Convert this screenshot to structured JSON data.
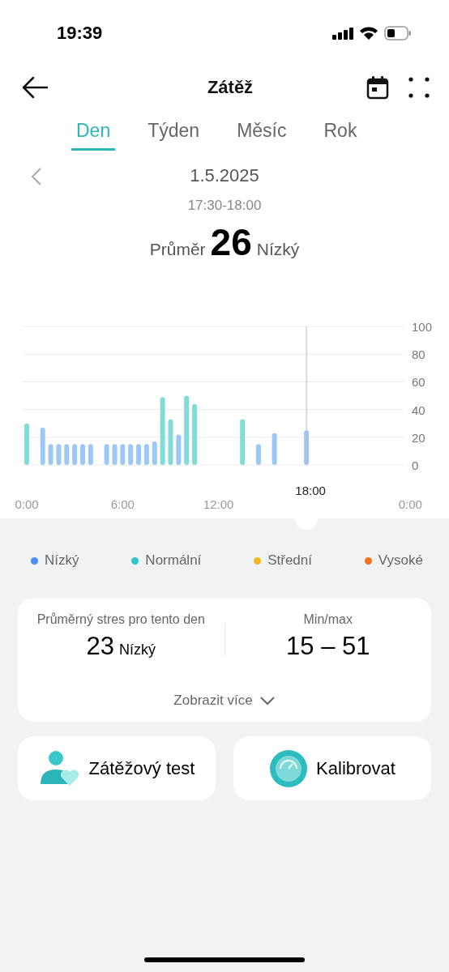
{
  "status_bar": {
    "time": "19:39"
  },
  "header": {
    "title": "Zátěž"
  },
  "tabs": [
    {
      "label": "Den",
      "selected": true
    },
    {
      "label": "Týden",
      "selected": false
    },
    {
      "label": "Měsíc",
      "selected": false
    },
    {
      "label": "Rok",
      "selected": false
    }
  ],
  "date_nav": {
    "date": "1.5.2025",
    "time_range": "17:30-18:00"
  },
  "summary": {
    "label": "Průměr",
    "value": "26",
    "level": "Nízký"
  },
  "chart": {
    "chart_data": {
      "type": "bar",
      "x": [
        0,
        1,
        1.5,
        2,
        2.5,
        3,
        3.5,
        4,
        5,
        5.5,
        6,
        6.5,
        7,
        7.5,
        8,
        8.5,
        9,
        9.5,
        10,
        10.5,
        13.5,
        14.5,
        15.5,
        17.5
      ],
      "series": [
        {
          "color": "#9cc8f8",
          "values": [
            null,
            27,
            15,
            15,
            15,
            15,
            15,
            15,
            15,
            15,
            15,
            15,
            15,
            15,
            17,
            null,
            null,
            22,
            null,
            null,
            null,
            15,
            23,
            25
          ]
        },
        {
          "color": "#7fdcd8",
          "values": [
            30,
            null,
            null,
            null,
            null,
            null,
            null,
            null,
            null,
            null,
            null,
            null,
            null,
            null,
            null,
            49,
            33,
            null,
            50,
            44,
            33,
            null,
            null,
            null
          ]
        }
      ],
      "xlim": [
        0,
        24
      ],
      "ylim": [
        0,
        100
      ],
      "yticks": [
        0,
        20,
        40,
        60,
        80,
        100
      ],
      "xticks": [
        {
          "value": 0,
          "label": "0:00"
        },
        {
          "value": 6,
          "label": "6:00"
        },
        {
          "value": 12,
          "label": "12:00"
        },
        {
          "value": 24,
          "label": "0:00"
        }
      ],
      "grid": true,
      "ref_lines": [
        {
          "axis": "x",
          "value": 17.5,
          "label": "18:00"
        }
      ]
    }
  },
  "legend": [
    {
      "label": "Nízký",
      "color": "#4a90f0"
    },
    {
      "label": "Normální",
      "color": "#2ec6c6"
    },
    {
      "label": "Střední",
      "color": "#f5b623"
    },
    {
      "label": "Vysoké",
      "color": "#f2711c"
    }
  ],
  "stats_card": {
    "average": {
      "label": "Průměrný stres pro tento den",
      "value": "23",
      "level": "Nízký"
    },
    "minmax": {
      "label": "Min/max",
      "value": "15 – 51"
    },
    "more": "Zobrazit více"
  },
  "actions": [
    {
      "kind": "stress_test",
      "label": "Zátěžový test"
    },
    {
      "kind": "calibrate",
      "label": "Kalibrovat"
    }
  ]
}
